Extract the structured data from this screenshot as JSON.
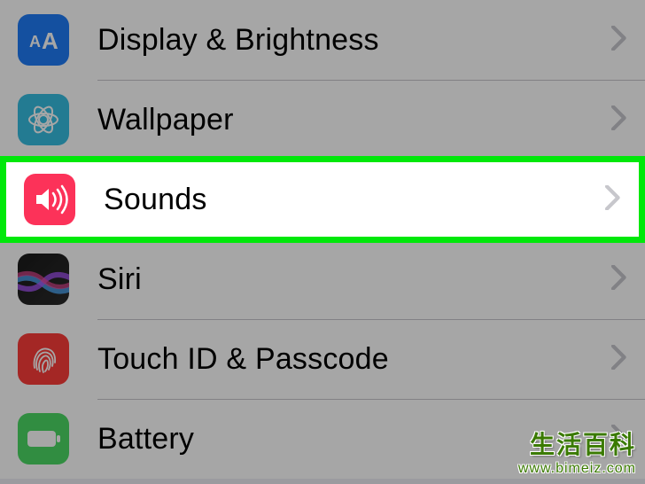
{
  "rows": {
    "display": {
      "label": "Display & Brightness"
    },
    "wallpaper": {
      "label": "Wallpaper"
    },
    "sounds": {
      "label": "Sounds"
    },
    "siri": {
      "label": "Siri"
    },
    "touchid": {
      "label": "Touch ID & Passcode"
    },
    "battery": {
      "label": "Battery"
    }
  },
  "watermark": {
    "title": "生活百科",
    "url": "www.bimeiz.com"
  },
  "colors": {
    "highlight": "#00e80a",
    "chevron": "#c7c7cc"
  }
}
